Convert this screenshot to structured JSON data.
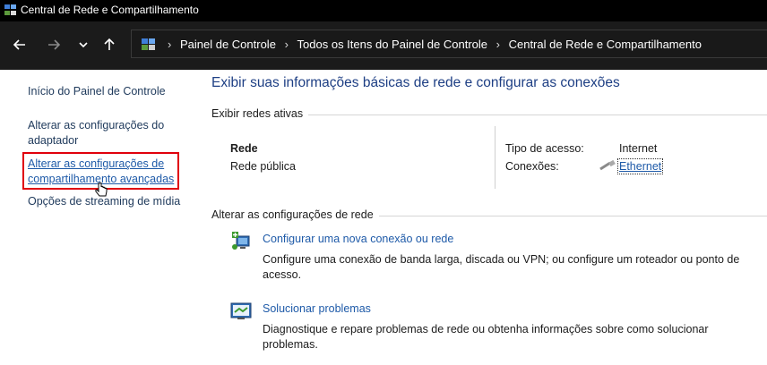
{
  "window": {
    "title": "Central de Rede e Compartilhamento",
    "icon": "network-center-icon"
  },
  "nav": {
    "back_icon": "arrow-left-icon",
    "forward_icon": "arrow-right-icon",
    "recent_icon": "chevron-down-icon",
    "up_icon": "arrow-up-icon"
  },
  "address": {
    "icon": "control-panel-icon",
    "crumbs": [
      "Painel de Controle",
      "Todos os Itens do Painel de Controle",
      "Central de Rede e Compartilhamento"
    ]
  },
  "sidebar": {
    "items": [
      {
        "label": "Início do Painel de Controle"
      },
      {
        "label_line1": "Alterar as configurações do",
        "label_line2": "adaptador"
      },
      {
        "label_line1": "Alterar as configurações de",
        "label_line2": "compartilhamento avançadas",
        "highlighted": true
      },
      {
        "label": "Opções de streaming de mídia"
      }
    ]
  },
  "main": {
    "title": "Exibir suas informações básicas de rede e configurar as conexões",
    "active_networks": {
      "label": "Exibir redes ativas",
      "network_name": "Rede",
      "network_type": "Rede pública",
      "access_type_label": "Tipo de acesso:",
      "access_type_value": "Internet",
      "connections_label": "Conexões:",
      "connection_link": "Ethernet"
    },
    "change_settings": {
      "label": "Alterar as configurações de rede",
      "tasks": [
        {
          "icon": "new-connection-icon",
          "title": "Configurar uma nova conexão ou rede",
          "description": "Configure uma conexão de banda larga, discada ou VPN; ou configure um roteador ou ponto de acesso."
        },
        {
          "icon": "troubleshoot-icon",
          "title": "Solucionar problemas",
          "description": "Diagnostique e repare problemas de rede ou obtenha informações sobre como solucionar problemas."
        }
      ]
    }
  },
  "colors": {
    "accent": "#1e5aa8",
    "title_blue": "#1e3f84",
    "highlight_box": "#e0000b"
  }
}
